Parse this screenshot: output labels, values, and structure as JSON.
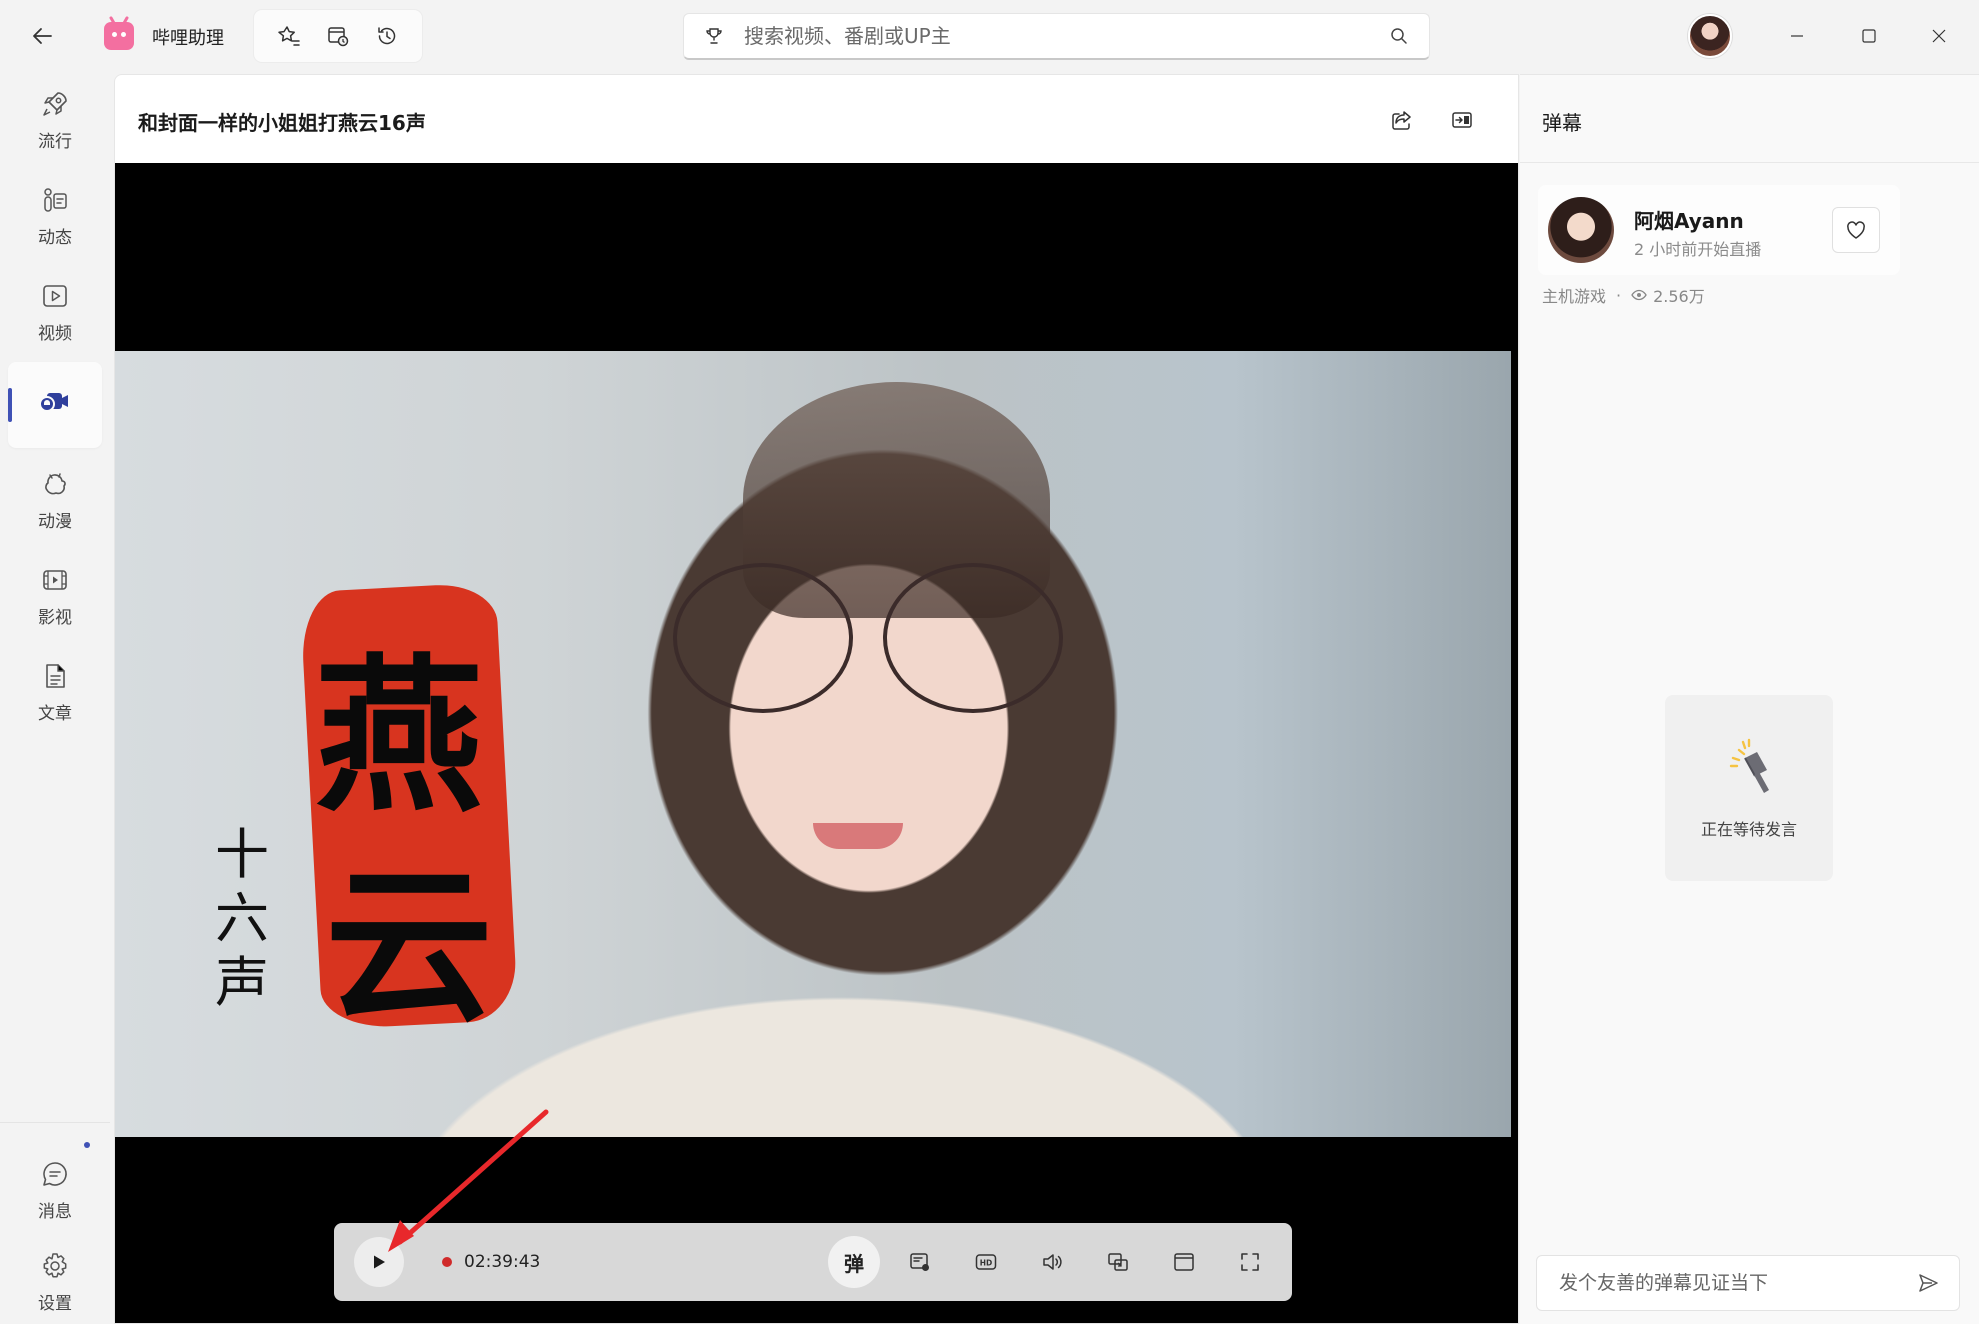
{
  "app": {
    "title": "哔哩助理"
  },
  "search": {
    "placeholder": "搜索视频、番剧或UP主"
  },
  "sidebar": {
    "items": [
      {
        "label": "流行",
        "icon": "rocket-icon"
      },
      {
        "label": "动态",
        "icon": "feed-icon"
      },
      {
        "label": "视频",
        "icon": "video-play-icon"
      },
      {
        "label": "",
        "icon": "live-camera-icon"
      },
      {
        "label": "动漫",
        "icon": "anime-icon"
      },
      {
        "label": "影视",
        "icon": "film-icon"
      },
      {
        "label": "文章",
        "icon": "article-icon"
      }
    ],
    "bottom": [
      {
        "label": "消息",
        "icon": "message-icon"
      },
      {
        "label": "设置",
        "icon": "gear-icon"
      }
    ]
  },
  "video": {
    "title": "和封面一样的小姐姐打燕云16声",
    "art_big_1": "燕",
    "art_big_2": "云",
    "art_small": "十六声"
  },
  "player": {
    "time": "02:39:43",
    "danmaku_label": "弹"
  },
  "right_panel": {
    "title": "弹幕",
    "streamer": {
      "name": "阿烟Ayann",
      "status": "2 小时前开始直播"
    },
    "category": "主机游戏",
    "separator": "·",
    "viewers": "2.56万",
    "waiting_text": "正在等待发言",
    "input_placeholder": "发个友善的弹幕见证当下"
  },
  "colors": {
    "accent": "#3f51b5",
    "live_dot": "#d02a2a",
    "annotation_arrow": "#e8282b",
    "art_red": "#d8341f"
  }
}
